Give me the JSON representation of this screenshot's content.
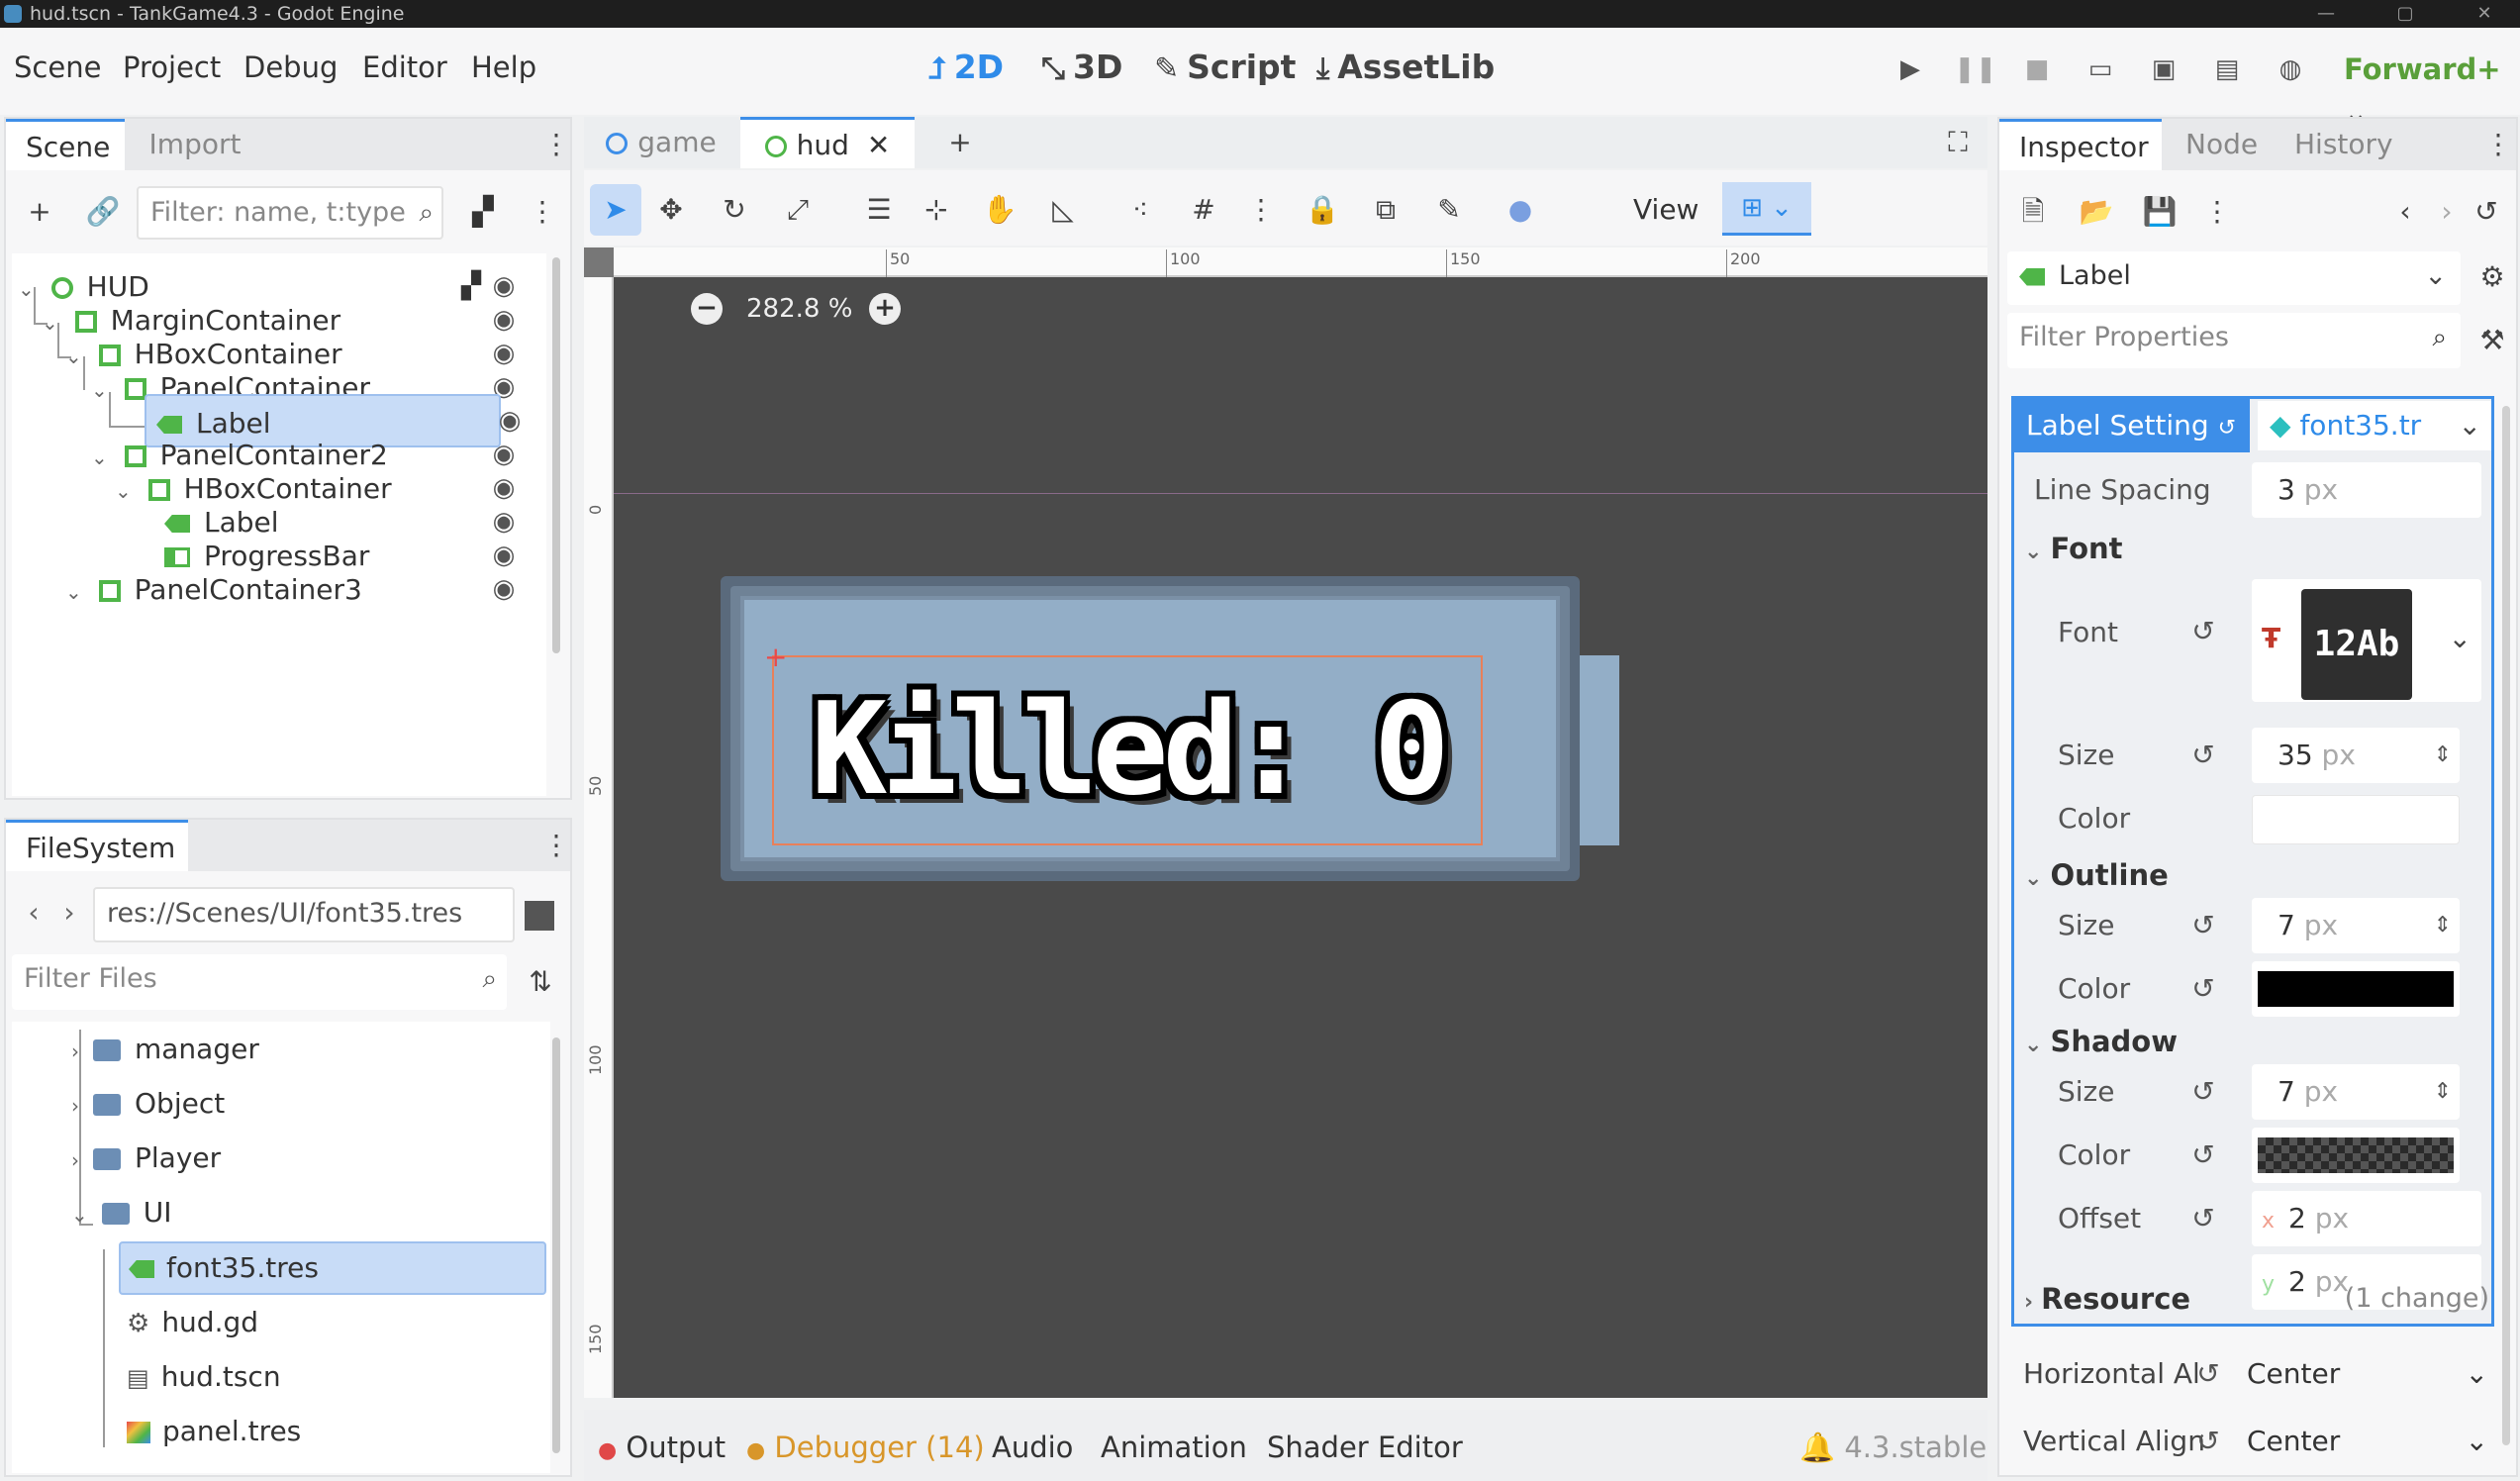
{
  "window": {
    "title": "hud.tscn - TankGame4.3 - Godot Engine"
  },
  "menu": [
    "Scene",
    "Project",
    "Debug",
    "Editor",
    "Help"
  ],
  "workspaces": [
    {
      "label": "2D",
      "icon": "2d-icon",
      "active": true
    },
    {
      "label": "3D",
      "icon": "3d-icon",
      "active": false
    },
    {
      "label": "Script",
      "icon": "script-icon",
      "active": false
    },
    {
      "label": "AssetLib",
      "icon": "assetlib-icon",
      "active": false
    }
  ],
  "renderer": "Forward+",
  "scene_dock": {
    "tabs": [
      "Scene",
      "Import"
    ],
    "filter_placeholder": "Filter: name, t:type",
    "tree": [
      {
        "label": "HUD",
        "depth": 0
      },
      {
        "label": "MarginContainer",
        "depth": 1
      },
      {
        "label": "HBoxContainer",
        "depth": 2
      },
      {
        "label": "PanelContainer",
        "depth": 3
      },
      {
        "label": "Label",
        "depth": 4,
        "selected": true
      },
      {
        "label": "PanelContainer2",
        "depth": 3
      },
      {
        "label": "HBoxContainer",
        "depth": 4
      },
      {
        "label": "Label",
        "depth": 5
      },
      {
        "label": "ProgressBar",
        "depth": 5
      },
      {
        "label": "PanelContainer3",
        "depth": 3
      }
    ]
  },
  "filesystem": {
    "tab": "FileSystem",
    "path": "res://Scenes/UI/font35.tres",
    "filter_placeholder": "Filter Files",
    "items": [
      {
        "label": "manager",
        "type": "folder"
      },
      {
        "label": "Object",
        "type": "folder"
      },
      {
        "label": "Player",
        "type": "folder"
      },
      {
        "label": "UI",
        "type": "folder",
        "open": true
      },
      {
        "label": "font35.tres",
        "type": "font",
        "selected": true
      },
      {
        "label": "hud.gd",
        "type": "script"
      },
      {
        "label": "hud.tscn",
        "type": "scene"
      },
      {
        "label": "panel.tres",
        "type": "stylebox"
      }
    ]
  },
  "editor_tabs": [
    {
      "label": "game",
      "active": false
    },
    {
      "label": "hud",
      "active": true
    }
  ],
  "toolbar": {
    "view_label": "View"
  },
  "viewport": {
    "zoom": "282.8 %",
    "ruler_top": [
      "50",
      "100",
      "150",
      "200"
    ],
    "ruler_left": [
      "0",
      "50",
      "100",
      "150"
    ],
    "hud_text": "Killed: 0"
  },
  "bottom_panel": {
    "tabs": [
      "Output",
      "Debugger (14)",
      "Audio",
      "Animation",
      "Shader Editor"
    ],
    "version": "4.3.stable"
  },
  "inspector": {
    "tabs": [
      "Inspector",
      "Node",
      "History"
    ],
    "node_type": "Label",
    "filter_placeholder": "Filter Properties",
    "section": "Label Setting",
    "resource_name": "font35.tr",
    "line_spacing": {
      "label": "Line Spacing",
      "value": "3",
      "unit": "px"
    },
    "font_section": "Font",
    "font": {
      "label": "Font",
      "preview": "12Ab"
    },
    "font_size": {
      "label": "Size",
      "value": "35",
      "unit": "px"
    },
    "font_color": {
      "label": "Color",
      "hex": "#ffffff"
    },
    "outline_section": "Outline",
    "outline_size": {
      "label": "Size",
      "value": "7",
      "unit": "px"
    },
    "outline_color": {
      "label": "Color",
      "hex": "#000000"
    },
    "shadow_section": "Shadow",
    "shadow_size": {
      "label": "Size",
      "value": "7",
      "unit": "px"
    },
    "shadow_color": {
      "label": "Color"
    },
    "shadow_offset": {
      "label": "Offset",
      "x": "2",
      "y": "2",
      "unit": "px",
      "x_label": "x",
      "y_label": "y"
    },
    "resource_section": "Resource",
    "resource_changes": "(1 change)",
    "horizontal_align": {
      "label": "Horizontal Al",
      "value": "Center"
    },
    "vertical_align": {
      "label": "Vertical Align",
      "value": "Center"
    }
  },
  "colors": {
    "accent": "#3d8ee8",
    "node_green": "#4fb548",
    "renderer_green": "#5a9f3a"
  }
}
